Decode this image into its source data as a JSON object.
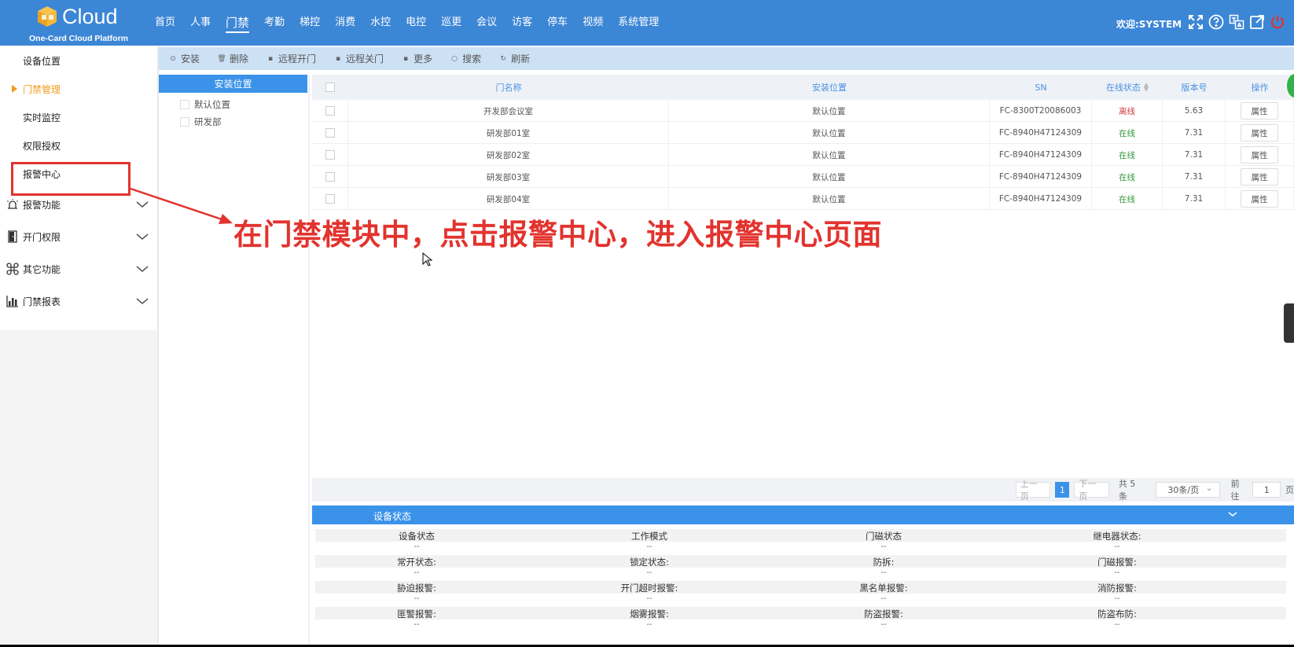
{
  "app": {
    "brand": "Cloud",
    "subtitle": "One-Card Cloud Platform",
    "welcome": "欢迎:SYSTEM"
  },
  "nav": [
    "首页",
    "人事",
    "门禁",
    "考勤",
    "梯控",
    "消费",
    "水控",
    "电控",
    "巡更",
    "会议",
    "访客",
    "停车",
    "视频",
    "系统管理"
  ],
  "nav_active": "门禁",
  "top_icons": [
    "fullscreen-icon",
    "help-icon",
    "translate-icon",
    "external-link-icon",
    "power-icon"
  ],
  "sidebar": {
    "items": [
      {
        "label": "设备位置"
      },
      {
        "label": "门禁管理",
        "active": true
      },
      {
        "label": "实时监控"
      },
      {
        "label": "权限授权"
      },
      {
        "label": "报警中心"
      }
    ],
    "groups": [
      {
        "label": "报警功能",
        "icon": "alarm-icon"
      },
      {
        "label": "开门权限",
        "icon": "door-icon"
      },
      {
        "label": "其它功能",
        "icon": "command-icon"
      },
      {
        "label": "门禁报表",
        "icon": "chart-icon"
      }
    ]
  },
  "toolbar": {
    "install": "安装",
    "delete": "删除",
    "remote_open": "远程开门",
    "remote_close": "远程关门",
    "more": "更多",
    "search": "搜索",
    "refresh": "刷新"
  },
  "tree": {
    "title": "安装位置",
    "items": [
      "默认位置",
      "研发部"
    ]
  },
  "table": {
    "headers": {
      "name": "门名称",
      "location": "安装位置",
      "sn": "SN",
      "status": "在线状态",
      "version": "版本号",
      "action": "操作"
    },
    "rows": [
      {
        "name": "开发部会议室",
        "location": "默认位置",
        "sn": "FC-8300T20086003",
        "status": "离线",
        "online": false,
        "version": "5.63",
        "action": "属性"
      },
      {
        "name": "研发部01室",
        "location": "默认位置",
        "sn": "FC-8940H47124309",
        "status": "在线",
        "online": true,
        "version": "7.31",
        "action": "属性"
      },
      {
        "name": "研发部02室",
        "location": "默认位置",
        "sn": "FC-8940H47124309",
        "status": "在线",
        "online": true,
        "version": "7.31",
        "action": "属性"
      },
      {
        "name": "研发部03室",
        "location": "默认位置",
        "sn": "FC-8940H47124309",
        "status": "在线",
        "online": true,
        "version": "7.31",
        "action": "属性"
      },
      {
        "name": "研发部04室",
        "location": "默认位置",
        "sn": "FC-8940H47124309",
        "status": "在线",
        "online": true,
        "version": "7.31",
        "action": "属性"
      }
    ]
  },
  "pager": {
    "prev": "上一页",
    "current": "1",
    "next": "下一页",
    "total": "共 5 条",
    "page_size": "30条/页",
    "goto_label": "前往",
    "goto_value": "1",
    "page_unit": "页"
  },
  "device_status": {
    "title": "设备状态",
    "rows": [
      [
        "设备状态",
        "工作模式",
        "门磁状态",
        "继电器状态:"
      ],
      [
        "常开状态:",
        "锁定状态:",
        "防拆:",
        "门磁报警:"
      ],
      [
        "胁迫报警:",
        "开门超时报警:",
        "黑名单报警:",
        "消防报警:"
      ],
      [
        "匪警报警:",
        "烟雾报警:",
        "防盗报警:",
        "防盗布防:"
      ]
    ],
    "empty_value": "--"
  },
  "annotation": {
    "text": "在门禁模块中，点击报警中心，进入报警中心页面",
    "color": "#e2332e"
  },
  "colors": {
    "header": "#3c86d6",
    "accent": "#3b93e9",
    "active_menu": "#f39a1c",
    "offline": "#d0373a",
    "online": "#2f9a3a"
  }
}
